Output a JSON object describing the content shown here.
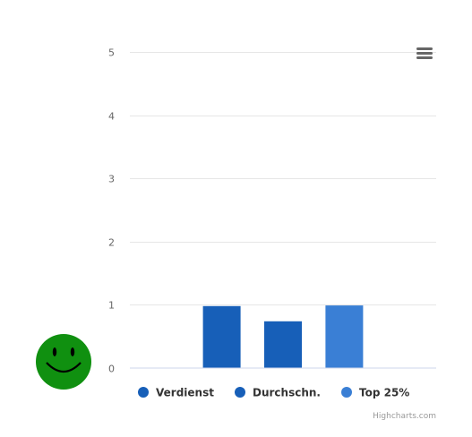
{
  "chart_data": {
    "type": "bar",
    "categories": [
      "Verdienst",
      "Durchschn.",
      "Top 25%"
    ],
    "values": [
      0.98,
      0.74,
      0.99
    ],
    "ylim": [
      0,
      5
    ],
    "yticks": [
      0,
      1,
      2,
      3,
      4,
      5
    ],
    "grid": true,
    "legend_position": "bottom",
    "series": [
      {
        "name": "Verdienst",
        "value": 0.98,
        "color": "#175fb8"
      },
      {
        "name": "Durchschn.",
        "value": 0.74,
        "color": "#175fb8"
      },
      {
        "name": "Top 25%",
        "value": 0.99,
        "color": "#3a7fd5"
      }
    ]
  },
  "credits": "Highcharts.com",
  "icons": {
    "menu": "hamburger-menu-icon",
    "smiley": "smiley-face-icon"
  },
  "colors": {
    "smiley": "#109010",
    "grid": "#e6e6e6",
    "axis": "#ccd6eb"
  }
}
